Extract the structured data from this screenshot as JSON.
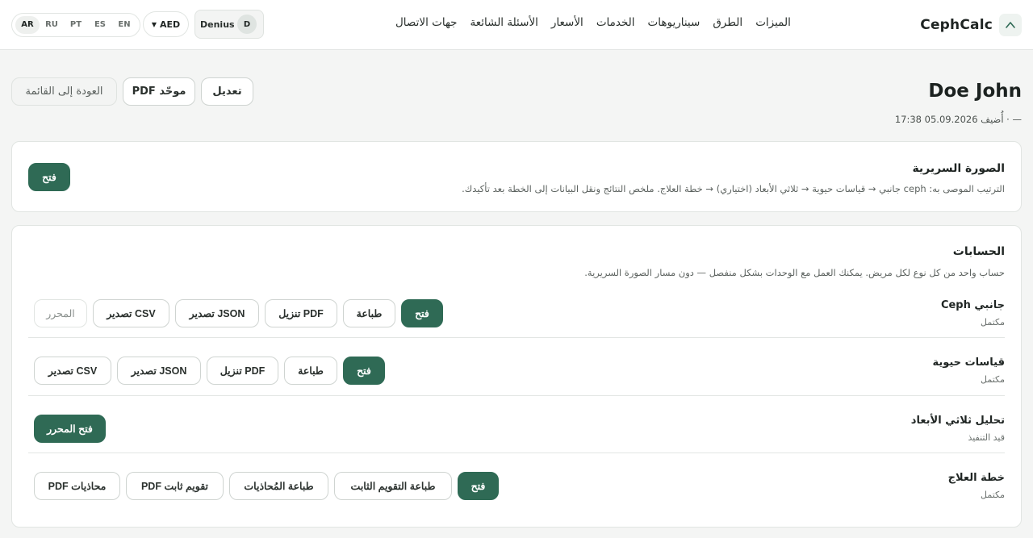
{
  "header": {
    "brand": "CephCalc",
    "nav": [
      "الميزات",
      "الطرق",
      "سيناريوهات",
      "الخدمات",
      "الأسعار",
      "الأسئلة الشائعة",
      "جهات الاتصال"
    ],
    "languages": [
      "AR",
      "RU",
      "PT",
      "ES",
      "EN"
    ],
    "active_language": "AR",
    "currency": "AED",
    "user_name": "Denius",
    "user_initial": "D"
  },
  "patient": {
    "name": "Doe John",
    "meta": "— · أُضيف 05.09.2026 17:38",
    "edit_label": "تعديل",
    "pdf_label": "PDF موحّد",
    "back_label": "العودة إلى القائمة"
  },
  "clinical": {
    "title": "الصورة السريرية",
    "description": "الترتيب الموصى به: ceph جانبي → قياسات حيوية → ثلاثي الأبعاد (اختياري) → خطة العلاج. ملخص النتائج ونقل البيانات إلى الخطة بعد تأكيدك.",
    "open_label": "فتح"
  },
  "calculations": {
    "title": "الحسابات",
    "description": "حساب واحد من كل نوع لكل مريض. يمكنك العمل مع الوحدات بشكل منفصل — دون مسار الصورة السريرية.",
    "rows": [
      {
        "title": "Ceph جانبي",
        "status": "مكتمل",
        "buttons": [
          "فتح",
          "طباعة",
          "تنزيل PDF",
          "تصدير JSON",
          "تصدير CSV",
          "المحرر"
        ]
      },
      {
        "title": "قياسات حيوية",
        "status": "مكتمل",
        "buttons": [
          "فتح",
          "طباعة",
          "تنزيل PDF",
          "تصدير JSON",
          "تصدير CSV"
        ]
      },
      {
        "title": "تحليل ثلاثي الأبعاد",
        "status": "قيد التنفيذ",
        "buttons": [
          "فتح المحرر"
        ]
      },
      {
        "title": "خطة العلاج",
        "status": "مكتمل",
        "buttons": [
          "فتح",
          "طباعة التقويم الثابت",
          "طباعة المُحاذيات",
          "PDF تقويم ثابت",
          "PDF محاذيات"
        ]
      }
    ]
  },
  "colors": {
    "accent": "#2f6a55",
    "background": "#f4f5f4",
    "card": "#ffffff"
  }
}
